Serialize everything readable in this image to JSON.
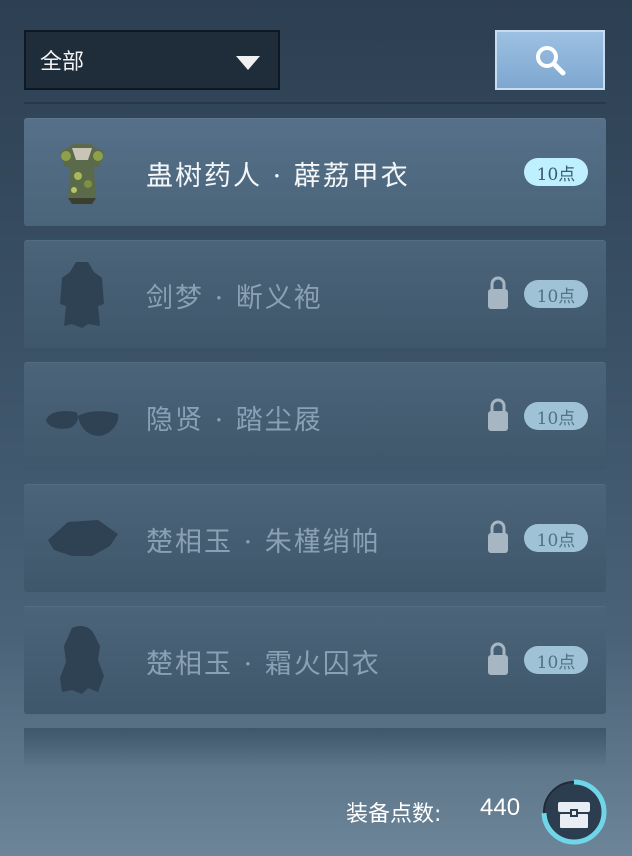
{
  "filter": {
    "selected": "全部"
  },
  "items": [
    {
      "name": "蛊树药人 · 薜荔甲衣",
      "points": "10点",
      "icon": "armor-icon",
      "locked": false
    },
    {
      "name": "剑梦 · 断义袍",
      "points": "10点",
      "icon": "robe-silhouette-icon",
      "locked": true
    },
    {
      "name": "隐贤 · 踏尘屐",
      "points": "10点",
      "icon": "shoes-silhouette-icon",
      "locked": true
    },
    {
      "name": "楚相玉 · 朱槿绡帕",
      "points": "10点",
      "icon": "handkerchief-silhouette-icon",
      "locked": true
    },
    {
      "name": "楚相玉 · 霜火囚衣",
      "points": "10点",
      "icon": "prison-robe-silhouette-icon",
      "locked": true
    }
  ],
  "footer": {
    "label": "装备点数:",
    "value": "440"
  },
  "colors": {
    "accent": "#7ea7cf",
    "badge_active": "#bff0ff",
    "badge_locked": "#9fc2d6",
    "ring": "#6fd6ea"
  }
}
